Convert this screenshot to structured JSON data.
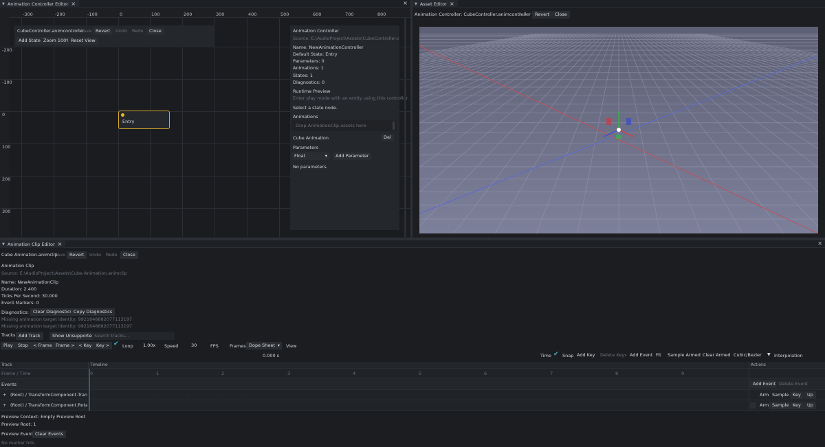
{
  "controller_tab": {
    "label": "Animation Controller Editor"
  },
  "controller_toolbar": {
    "file": "CubeController.animcontroller",
    "save": "Save",
    "revert": "Revert",
    "undo": "Undo",
    "redo": "Redo",
    "close": "Close",
    "add_state": "Add State",
    "zoom": "Zoom 100%",
    "reset_view": "Reset View"
  },
  "ruler_x": [
    "-300",
    "-200",
    "-100",
    "0",
    "100",
    "200",
    "300",
    "400",
    "500",
    "600",
    "700",
    "800"
  ],
  "ruler_y": [
    "-200",
    "-100",
    "0",
    "100",
    "200",
    "300"
  ],
  "entry_node": {
    "label": "Entry"
  },
  "inspector": {
    "title": "Animation Controller",
    "source": "Source: E:\\AudioProject\\Assets\\CubeController.animco",
    "name": "Name: NewAnimationController",
    "default_state": "Default State: Entry",
    "parameters_count": "Parameters: 0",
    "animations_count": "Animations: 1",
    "states_count": "States: 1",
    "diagnostics_count": "Diagnostics: 0",
    "runtime_preview": "Runtime Preview",
    "runtime_hint": "Enter play mode with an entity using this controller.",
    "select_state": "Select a state node.",
    "animations_header": "Animations",
    "drop_hint": "Drop AnimationClip assets here",
    "animation_item": "Cube Animation",
    "delete": "Del",
    "parameters_header": "Parameters",
    "param_type": "Float",
    "add_parameter": "Add Parameter",
    "no_parameters": "No parameters."
  },
  "asset_tab": {
    "label": "Asset Editor"
  },
  "asset_toolbar": {
    "title": "Animation Controller: CubeController.animcontroller",
    "save": "Save",
    "revert": "Revert",
    "close": "Close"
  },
  "viewport": {
    "colors": {
      "sky": "#63667c",
      "ground": "#7a7d97",
      "x_axis": "#c0505a",
      "z_axis": "#5a6ad0"
    }
  },
  "clip_tab": {
    "label": "Animation Clip Editor"
  },
  "clip_toolbar": {
    "file": "Cube Animation.animclip",
    "save": "Save",
    "revert": "Revert",
    "undo": "Undo",
    "redo": "Redo",
    "close": "Close"
  },
  "clip_info": {
    "header": "Animation Clip",
    "source": "Source: E:\\AudioProject\\Assets\\Cube Animation.animclip",
    "name": "Name: NewAnimationClip",
    "duration": "Duration: 2.400",
    "ticks": "Ticks Per Second: 30.000",
    "markers": "Event Markers: 0",
    "diagnostics": "Diagnostics: 2",
    "clear_diag": "Clear Diagnostics",
    "copy_diag": "Copy Diagnostics",
    "missing1": "Missing animation target identity: 9921648882077113197",
    "missing2": "Missing animation target identity: 9921648882077113197"
  },
  "tracks_bar": {
    "label": "Tracks",
    "add_track": "Add Track",
    "show_unsupported": "Show Unsupported",
    "search_placeholder": "Search tracks..."
  },
  "transport": {
    "play": "Play",
    "stop": "Stop",
    "prev_frame": "< Frame",
    "next_frame": "Frame >",
    "prev_key": "< Key",
    "next_key": "Key >",
    "loop": "Loop",
    "speed_value": "1.00x",
    "speed_label": "Speed",
    "fps_value": "30",
    "fps_label": "FPS",
    "frames": "Frames",
    "view_mode": "Dope Sheet",
    "view": "View"
  },
  "time_bar": {
    "time_value": "0.000 s",
    "time": "Time",
    "snap": "Snap",
    "add_key": "Add Key",
    "delete_keys": "Delete Keys",
    "add_event": "Add Event",
    "fit": "Fit",
    "sample_armed": "Sample Armed",
    "clear_armed": "Clear Armed",
    "interp_mode": "Cubic/Bezier",
    "interpolation": "Interpolation"
  },
  "timeline": {
    "col_track": "Track",
    "col_timeline": "Timeline",
    "col_actions": "Actions",
    "frame_time": "Frame / Time",
    "ticks": [
      "0",
      "1",
      "2",
      "3",
      "4",
      "5",
      "6",
      "7",
      "8",
      "9"
    ],
    "events_label": "Events",
    "add_event": "Add Event",
    "delete_event": "Delete Event",
    "tracks": [
      {
        "name": "(Root) / TransformComponent.Translatio",
        "arm": "Arm",
        "sample": "Sample",
        "key": "Key",
        "up": "Up"
      },
      {
        "name": "(Root) / TransformComponent.Rotation",
        "arm": "Arm",
        "sample": "Sample",
        "key": "Key",
        "up": "Up"
      }
    ]
  },
  "preview": {
    "context": "Preview Context: Empty Preview Root",
    "root": "Preview Root: 1",
    "events": "Preview Events",
    "clear_events": "Clear Events",
    "no_hits": "No marker hits."
  }
}
